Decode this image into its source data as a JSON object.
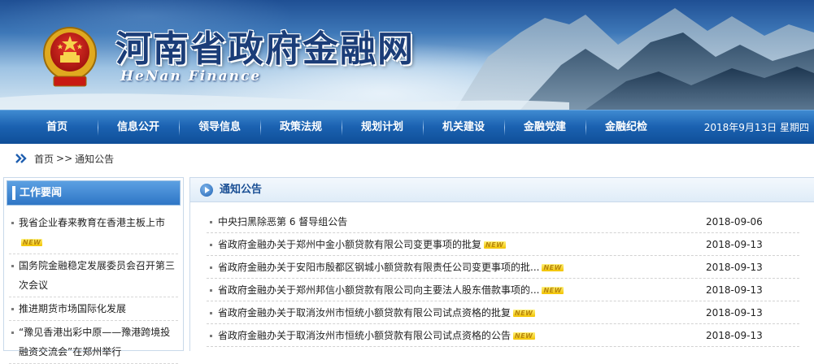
{
  "header": {
    "title": "河南省政府金融网",
    "subtitle": "HeNan Finance",
    "emblem_icon": "national-emblem-icon"
  },
  "nav": {
    "items": [
      {
        "label": "首页"
      },
      {
        "label": "信息公开"
      },
      {
        "label": "领导信息"
      },
      {
        "label": "政策法规"
      },
      {
        "label": "规划计划"
      },
      {
        "label": "机关建设"
      },
      {
        "label": "金融党建"
      },
      {
        "label": "金融纪检"
      }
    ],
    "date": "2018年9月13日 星期四"
  },
  "breadcrumb": {
    "icon": "double-chevron-right-icon",
    "home": "首页",
    "separator": ">>",
    "current": "通知公告"
  },
  "sidebar": {
    "title": "工作要闻",
    "items": [
      {
        "label": "我省企业春来教育在香港主板上市",
        "new": "NEW"
      },
      {
        "label": "国务院金融稳定发展委员会召开第三次会议"
      },
      {
        "label": "推进期货市场国际化发展"
      },
      {
        "label": "“豫见香港出彩中原——豫港跨境投融资交流会”在郑州举行"
      }
    ]
  },
  "main": {
    "title": "通知公告",
    "notices": [
      {
        "title": "中央扫黑除恶第 6 督导组公告",
        "new": "",
        "date": "2018-09-06"
      },
      {
        "title": "省政府金融办关于郑州中金小额贷款有限公司变更事项的批复",
        "new": "NEW",
        "date": "2018-09-13"
      },
      {
        "title": "省政府金融办关于安阳市殷都区钢城小额贷款有限责任公司变更事项的批...",
        "new": "NEW",
        "date": "2018-09-13"
      },
      {
        "title": "省政府金融办关于郑州邦信小额贷款有限公司向主要法人股东借款事项的...",
        "new": "NEW",
        "date": "2018-09-13"
      },
      {
        "title": "省政府金融办关于取消汝州市恒统小额贷款有限公司试点资格的批复",
        "new": "NEW",
        "date": "2018-09-13"
      },
      {
        "title": "省政府金融办关于取消汝州市恒统小额贷款有限公司试点资格的公告",
        "new": "NEW",
        "date": "2018-09-13"
      }
    ]
  },
  "colors": {
    "nav_blue": "#1b62b1",
    "title_blue": "#1a4f94",
    "new_badge": "#f2c200"
  }
}
